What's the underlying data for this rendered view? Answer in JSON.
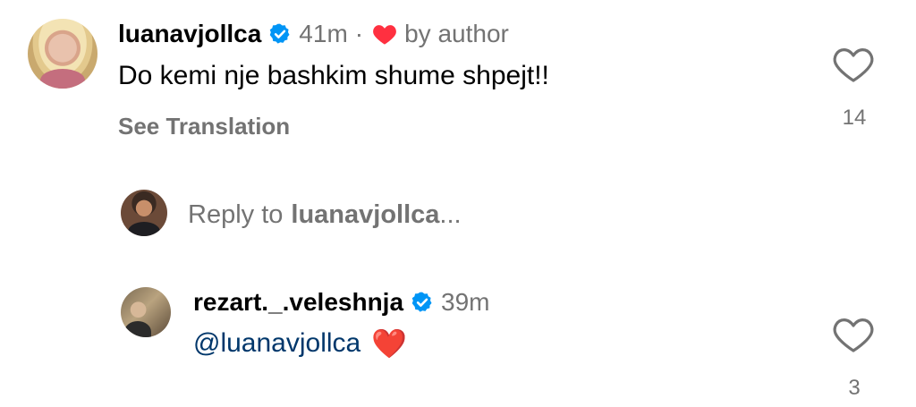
{
  "comment_main": {
    "username": "luanavjollca",
    "time": "41m",
    "separator": "·",
    "liked_by_author_text": "by author",
    "text": "Do kemi nje bashkim shume shpejt!!",
    "see_translation": "See Translation",
    "like_count": "14"
  },
  "reply_input": {
    "prefix": "Reply to",
    "target": "luanavjollca",
    "suffix": "..."
  },
  "comment_reply": {
    "username": "rezart._.veleshnja",
    "time": "39m",
    "mention": "@luanavjollca",
    "emoji": "❤️",
    "like_count": "3"
  },
  "colors": {
    "verified_blue": "#0095f6",
    "heart_red": "#ff3040",
    "secondary_text": "#737373",
    "mention_blue": "#00376b"
  },
  "icons": [
    "verified-badge-icon",
    "heart-filled-icon",
    "heart-outline-icon"
  ]
}
